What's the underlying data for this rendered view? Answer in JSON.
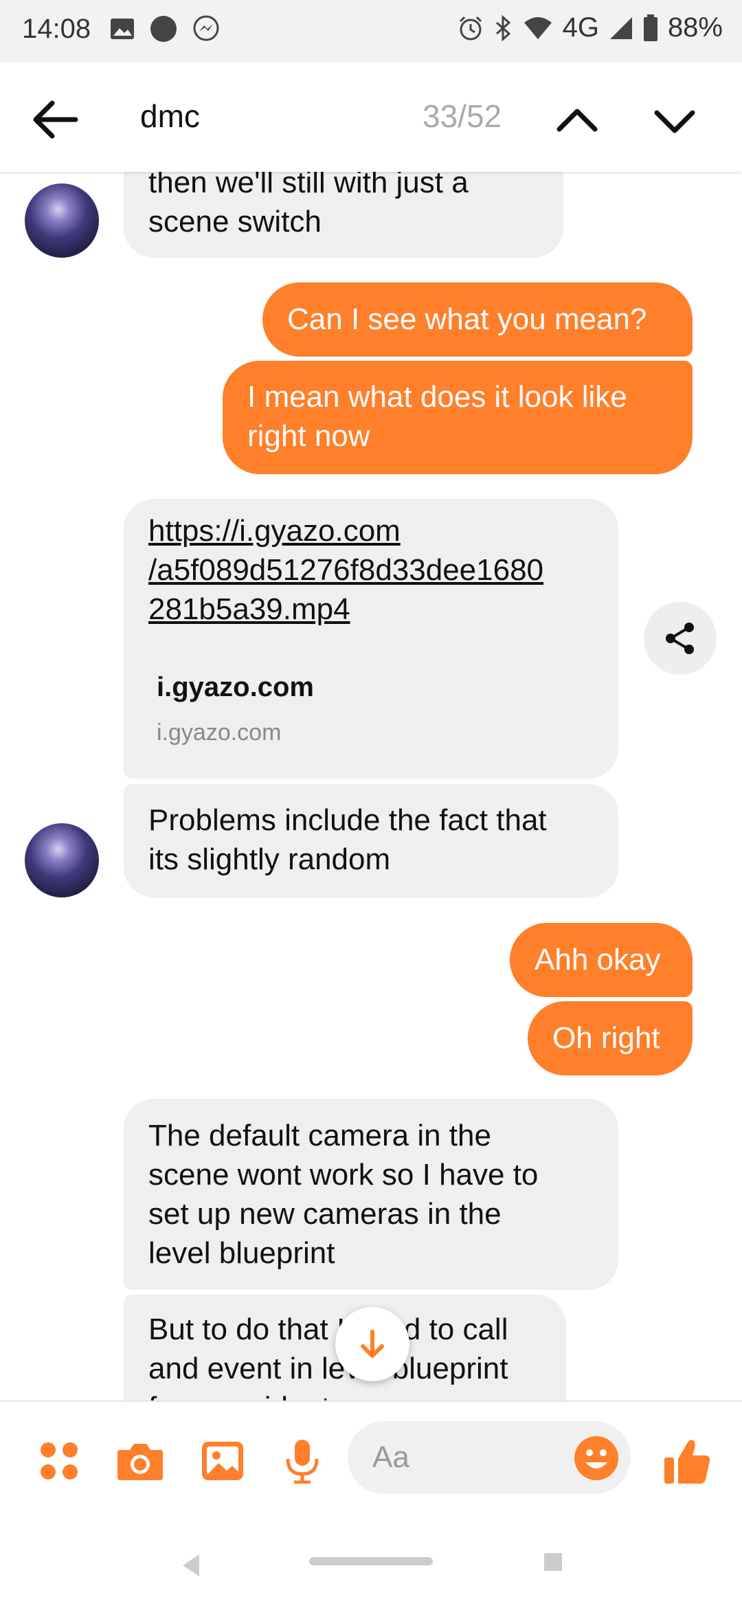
{
  "status_bar": {
    "time": "14:08",
    "network": "4G",
    "battery": "88%",
    "icons": [
      "image-icon",
      "circle-icon",
      "messenger-icon",
      "alarm-icon",
      "bluetooth-icon",
      "wifi-icon",
      "signal-icon",
      "battery-icon"
    ]
  },
  "header": {
    "search_query": "dmc",
    "match_counter": "33/52",
    "icons": [
      "back-arrow-icon",
      "chevron-up-icon",
      "chevron-down-icon"
    ]
  },
  "messages": [
    {
      "side": "in",
      "text_lines": [
        "then we'll still with just a",
        "scene switch"
      ]
    },
    {
      "side": "out",
      "text": "Can I see what you mean?"
    },
    {
      "side": "out",
      "text_lines": [
        "I mean what does it look like",
        "right now"
      ]
    },
    {
      "side": "in",
      "type": "link",
      "url_lines": [
        "https://i.gyazo.com",
        "/a5f089d51276f8d33dee1680",
        "281b5a39.mp4"
      ],
      "preview_title": "i.gyazo.com",
      "preview_domain": "i.gyazo.com"
    },
    {
      "side": "in",
      "text_lines": [
        "Problems include the fact that",
        "its slightly random"
      ]
    },
    {
      "side": "out",
      "text": "Ahh okay"
    },
    {
      "side": "out",
      "text": "Oh right"
    },
    {
      "side": "in",
      "text_lines": [
        "The default camera in the",
        "scene wont work so I have to",
        "set up new cameras in the",
        "level blueprint"
      ]
    },
    {
      "side": "in",
      "text_lines": [
        "But to do that I need to call",
        "and event in level blueprint",
        "from a widget"
      ]
    }
  ],
  "composer": {
    "placeholder": "Aa",
    "icons": [
      "apps-icon",
      "camera-icon",
      "gallery-icon",
      "microphone-icon",
      "emoji-icon",
      "thumbs-up-icon"
    ]
  },
  "colors": {
    "accent": "#FF7F2A",
    "incoming_bubble": "#EFEFEF"
  }
}
